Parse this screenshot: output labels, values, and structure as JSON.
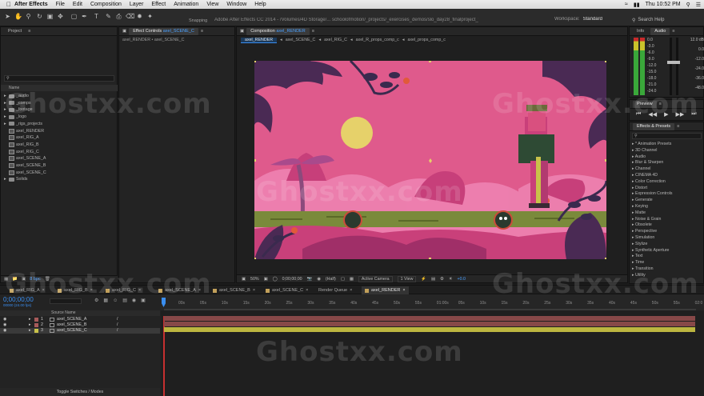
{
  "menubar": {
    "app_name": "After Effects",
    "items": [
      "File",
      "Edit",
      "Composition",
      "Layer",
      "Effect",
      "Animation",
      "View",
      "Window",
      "Help"
    ],
    "clock": "Thu 10:52 PM"
  },
  "toolbar": {
    "doc_title": "Adobe After Effects CC 2014 - /Volumes/4D Storage/... schoolofmotion/_projects/_exercises_demos/slo_day28_finalproject_v15.aep *",
    "snapping": "Snapping",
    "workspace_label": "Workspace:",
    "workspace_value": "Standard",
    "search_placeholder": "Search Help"
  },
  "project": {
    "tab": "Project",
    "col_name": "Name",
    "items": [
      {
        "name": "_audio",
        "type": "folder"
      },
      {
        "name": "_comps",
        "type": "folder"
      },
      {
        "name": "_footage",
        "type": "folder"
      },
      {
        "name": "_logo",
        "type": "folder"
      },
      {
        "name": "_rigs_projects",
        "type": "folder"
      },
      {
        "name": "axel_RENDER",
        "type": "comp"
      },
      {
        "name": "axel_RIG_A",
        "type": "comp"
      },
      {
        "name": "axel_RIG_B",
        "type": "comp"
      },
      {
        "name": "axel_RIG_C",
        "type": "comp"
      },
      {
        "name": "axel_SCENE_A",
        "type": "comp"
      },
      {
        "name": "axel_SCENE_B",
        "type": "comp"
      },
      {
        "name": "axel_SCENE_C",
        "type": "comp"
      },
      {
        "name": "Solids",
        "type": "folder"
      }
    ],
    "bpc": "8 bpc"
  },
  "effect_controls": {
    "tab_label": "Effect Controls",
    "tab_target": "axel_SCENE_C",
    "breadcrumb": "axel_RENDER • axel_SCENE_C"
  },
  "composition": {
    "tab_label": "Composition",
    "tab_target": "axel_RENDER",
    "subtabs": [
      "axel_RENDER",
      "axel_SCENE_C",
      "axel_RIG_C",
      "axel_R_props_comp_c",
      "axel_props_comp_c"
    ],
    "footer": {
      "zoom": "50%",
      "timecode": "0;00;00;00",
      "resolution": "(Half)",
      "camera": "Active Camera",
      "views": "1 View",
      "exposure": "+0.0"
    }
  },
  "info": {
    "tab_info": "Info",
    "tab_audio": "Audio",
    "db_left": [
      "0.0",
      "-3.0",
      "-6.0",
      "-9.0",
      "-12.0",
      "-15.0",
      "-18.0",
      "-21.0",
      "-24.0"
    ],
    "db_right": [
      "12.0 dB",
      "0.0",
      "-12.0",
      "-24.0",
      "-36.0",
      "-48.0"
    ]
  },
  "preview": {
    "tab": "Preview"
  },
  "effects": {
    "tab": "Effects & Presets",
    "categories": [
      "* Animation Presets",
      "3D Channel",
      "Audio",
      "Blur & Sharpen",
      "Channel",
      "CINEMA 4D",
      "Color Correction",
      "Distort",
      "Expression Controls",
      "Generate",
      "Keying",
      "Matte",
      "Noise & Grain",
      "Obsolete",
      "Perspective",
      "Simulation",
      "Stylize",
      "Synthetic Aperture",
      "Text",
      "Time",
      "Transition",
      "Utility"
    ]
  },
  "timeline_tabs": [
    "axel_RIG_A",
    "axel_RIG_B",
    "axel_RIG_C",
    "axel_SCENE_A",
    "axel_SCENE_B",
    "axel_SCENE_C",
    "Render Queue",
    "axel_RENDER"
  ],
  "timeline": {
    "timecode": "0;00;00;00",
    "fps": "00000 (24.00 fps)",
    "col_source": "Source Name",
    "layers": [
      {
        "num": "1",
        "name": "axel_SCENE_A",
        "color": "#a65a5a"
      },
      {
        "num": "2",
        "name": "axel_SCENE_B",
        "color": "#a65a5a"
      },
      {
        "num": "3",
        "name": "axel_SCENE_C",
        "color": "#c9c24a"
      }
    ],
    "ruler": [
      "00s",
      "05s",
      "10s",
      "15s",
      "20s",
      "25s",
      "30s",
      "35s",
      "40s",
      "45s",
      "50s",
      "55s",
      "01:00s",
      "05s",
      "10s",
      "15s",
      "20s",
      "25s",
      "30s",
      "35s",
      "40s",
      "45s",
      "50s",
      "55s",
      "02:0"
    ],
    "footer": "Toggle Switches / Modes"
  },
  "colors": {
    "accent": "#2d8ceb",
    "canvas_bg": "#df5a8c",
    "layer_red": "#a65a5a",
    "layer_yellow": "#c9c24a"
  }
}
